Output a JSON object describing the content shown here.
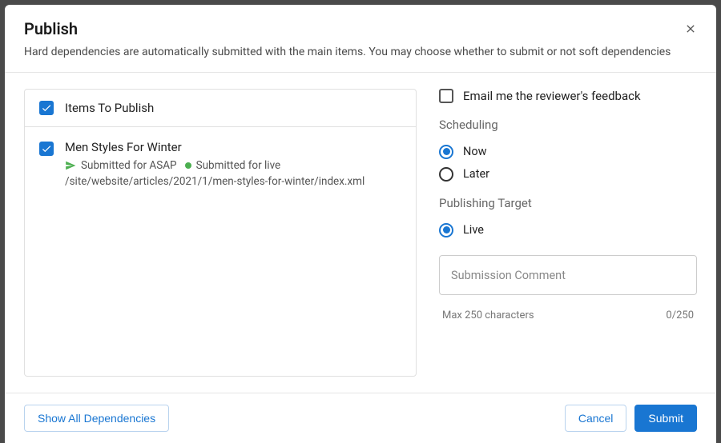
{
  "header": {
    "title": "Publish",
    "subtitle": "Hard dependencies are automatically submitted with the main items. You may choose whether to submit or not soft dependencies"
  },
  "itemsPanel": {
    "heading": "Items To Publish",
    "item": {
      "title": "Men Styles For Winter",
      "status1": "Submitted for ASAP",
      "status2": "Submitted for live",
      "path": "/site/website/articles/2021/1/men-styles-for-winter/index.xml"
    }
  },
  "options": {
    "emailFeedback": "Email me the reviewer's feedback",
    "schedulingHeading": "Scheduling",
    "scheduling": {
      "now": "Now",
      "later": "Later"
    },
    "targetHeading": "Publishing Target",
    "target": {
      "live": "Live"
    },
    "commentPlaceholder": "Submission Comment",
    "maxCharsLabel": "Max 250 characters",
    "charCount": "0/250"
  },
  "footer": {
    "showDeps": "Show All Dependencies",
    "cancel": "Cancel",
    "submit": "Submit"
  }
}
